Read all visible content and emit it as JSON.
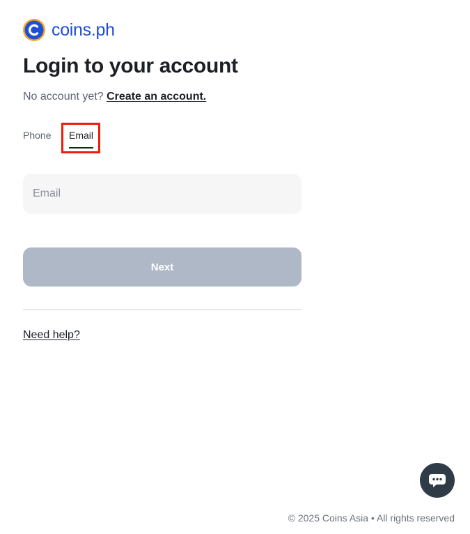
{
  "brand": {
    "name": "coins.ph",
    "color": "#1f4fd6"
  },
  "page": {
    "title": "Login to your account",
    "no_account_text": "No account yet?",
    "create_account_link": "Create an account."
  },
  "tabs": [
    {
      "label": "Phone",
      "selected": false
    },
    {
      "label": "Email",
      "selected": true
    }
  ],
  "form": {
    "email_placeholder": "Email",
    "email_value": "",
    "next_label": "Next"
  },
  "help_link": "Need help?",
  "footer": {
    "copyright": "© 2025 Coins Asia",
    "separator": "•",
    "rights": "All rights reserved"
  },
  "icons": {
    "logo": "coins-logo-icon",
    "chat": "chat-bubble-icon"
  },
  "colors": {
    "highlight": "#f01b0a",
    "button_disabled": "#aeb8c6",
    "chat_bg": "#2f3b47"
  }
}
